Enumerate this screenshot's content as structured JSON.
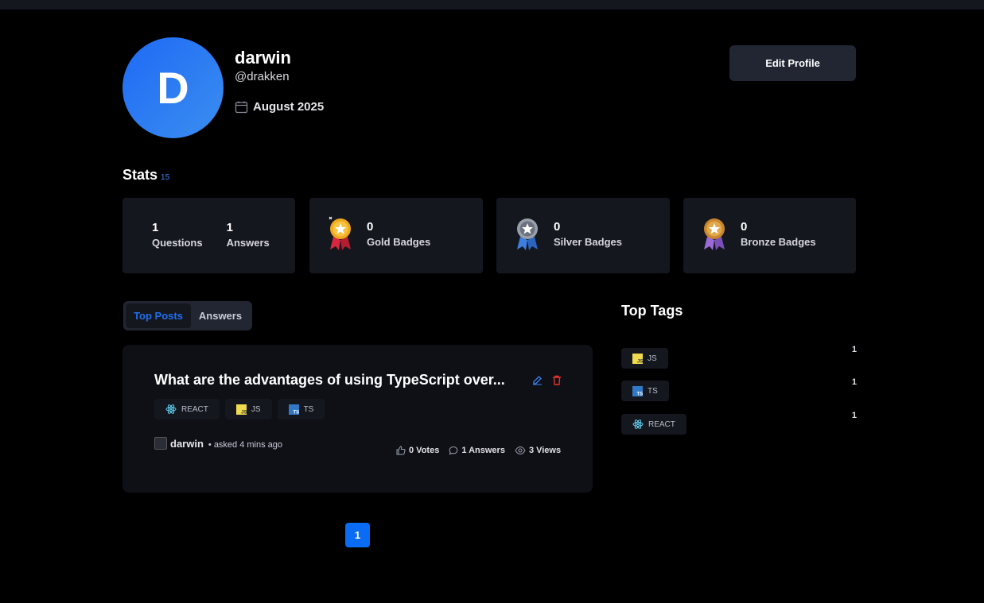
{
  "profile": {
    "avatar_letter": "D",
    "name": "darwin",
    "handle": "@drakken",
    "joined": "August 2025",
    "edit_label": "Edit Profile"
  },
  "stats": {
    "title": "Stats",
    "reputation": "15",
    "questions": {
      "value": "1",
      "label": "Questions"
    },
    "answers": {
      "value": "1",
      "label": "Answers"
    },
    "badges": [
      {
        "value": "0",
        "label": "Gold Badges",
        "icon": "gold-medal-icon"
      },
      {
        "value": "0",
        "label": "Silver Badges",
        "icon": "silver-medal-icon"
      },
      {
        "value": "0",
        "label": "Bronze Badges",
        "icon": "bronze-medal-icon"
      }
    ]
  },
  "tabs": [
    {
      "label": "Top Posts",
      "active": true
    },
    {
      "label": "Answers",
      "active": false
    }
  ],
  "post": {
    "title": "What are the advantages of using TypeScript over...",
    "tags": [
      "REACT",
      "JS",
      "TS"
    ],
    "author": "darwin",
    "asked": "• asked 4 mins ago",
    "votes": "0 Votes",
    "answers": "1 Answers",
    "views": "3 Views"
  },
  "pagination": {
    "current": "1"
  },
  "top_tags": {
    "title": "Top Tags",
    "items": [
      {
        "name": "JS",
        "count": "1"
      },
      {
        "name": "TS",
        "count": "1"
      },
      {
        "name": "REACT",
        "count": "1"
      }
    ]
  },
  "colors": {
    "accent": "#1f6feb",
    "card": "#15171f",
    "danger": "#e5322d"
  }
}
